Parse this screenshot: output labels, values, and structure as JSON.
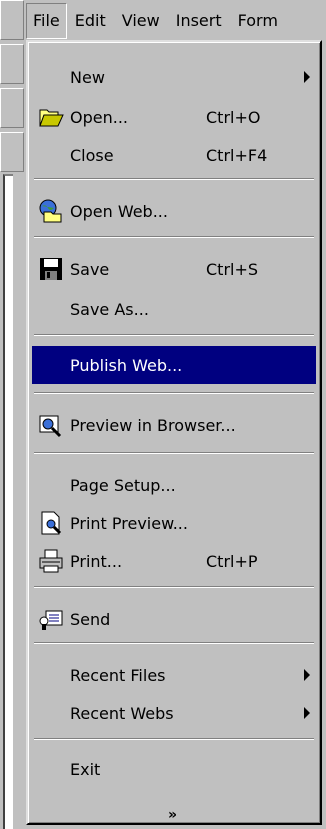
{
  "menubar": {
    "items": [
      "File",
      "Edit",
      "View",
      "Insert",
      "Form"
    ]
  },
  "file_menu": {
    "items": [
      {
        "label": "New",
        "shortcut": "",
        "submenu": true,
        "icon": ""
      },
      {
        "label": "Open...",
        "shortcut": "Ctrl+O",
        "submenu": false,
        "icon": "open-folder-icon"
      },
      {
        "label": "Close",
        "shortcut": "Ctrl+F4",
        "submenu": false,
        "icon": ""
      },
      {
        "label": "Open Web...",
        "shortcut": "",
        "submenu": false,
        "icon": "open-web-icon"
      },
      {
        "label": "Save",
        "shortcut": "Ctrl+S",
        "submenu": false,
        "icon": "floppy-disk-icon"
      },
      {
        "label": "Save As...",
        "shortcut": "",
        "submenu": false,
        "icon": ""
      },
      {
        "label": "Publish Web...",
        "shortcut": "",
        "submenu": false,
        "icon": "",
        "selected": true
      },
      {
        "label": "Preview in Browser...",
        "shortcut": "",
        "submenu": false,
        "icon": "preview-browser-icon"
      },
      {
        "label": "Page Setup...",
        "shortcut": "",
        "submenu": false,
        "icon": ""
      },
      {
        "label": "Print Preview...",
        "shortcut": "",
        "submenu": false,
        "icon": "print-preview-icon"
      },
      {
        "label": "Print...",
        "shortcut": "Ctrl+P",
        "submenu": false,
        "icon": "printer-icon"
      },
      {
        "label": "Send",
        "shortcut": "",
        "submenu": false,
        "icon": "send-mail-icon"
      },
      {
        "label": "Recent Files",
        "shortcut": "",
        "submenu": true,
        "icon": ""
      },
      {
        "label": "Recent Webs",
        "shortcut": "",
        "submenu": true,
        "icon": ""
      },
      {
        "label": "Exit",
        "shortcut": "",
        "submenu": false,
        "icon": ""
      }
    ],
    "expand_glyph": "»"
  },
  "colors": {
    "face": "#c0c0c0",
    "highlight": "#000080",
    "highlight_text": "#ffffff"
  }
}
